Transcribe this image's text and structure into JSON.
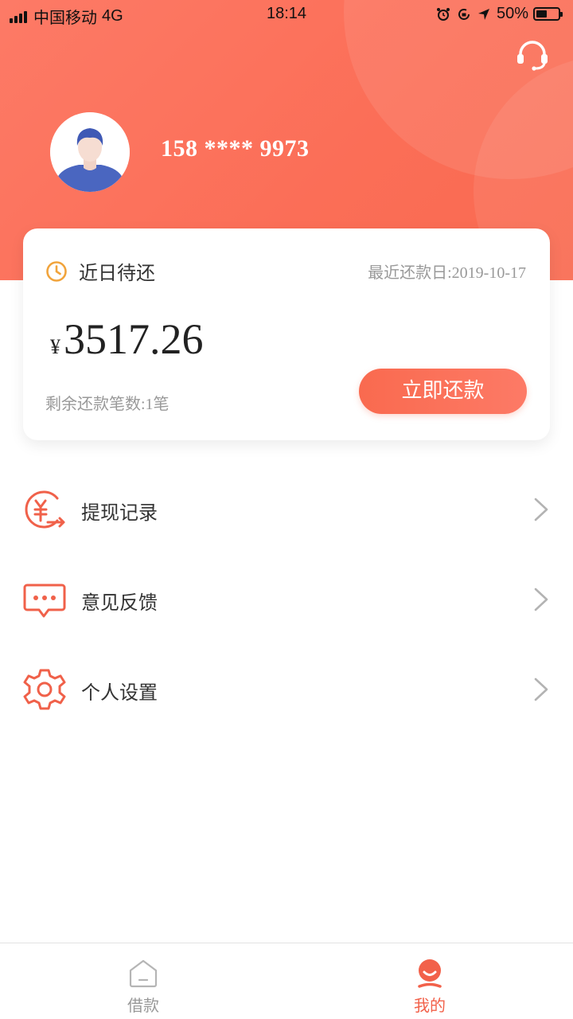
{
  "status_bar": {
    "carrier": "中国移动",
    "network": "4G",
    "time": "18:14",
    "battery_percent": "50%",
    "battery_level": 0.5
  },
  "header": {
    "phone": "158 **** 9973",
    "bg_color": "#fb6e57"
  },
  "card": {
    "title": "近日待还",
    "recent_date": "最近还款日:2019-10-17",
    "currency": "¥",
    "amount": "3517.26",
    "remaining": "剩余还款笔数:1笔",
    "repay_button": "立即还款"
  },
  "menu": {
    "items": [
      {
        "label": "提现记录",
        "icon": "yuan-withdraw-icon"
      },
      {
        "label": "意见反馈",
        "icon": "chat-bubble-icon"
      },
      {
        "label": "个人设置",
        "icon": "gear-icon"
      }
    ]
  },
  "bottom_nav": {
    "tabs": [
      {
        "label": "借款",
        "icon": "home-icon",
        "active": false
      },
      {
        "label": "我的",
        "icon": "profile-icon",
        "active": true
      }
    ],
    "active_color": "#f2614a",
    "inactive_color": "#999999"
  },
  "accent_color": "#f96a4f"
}
